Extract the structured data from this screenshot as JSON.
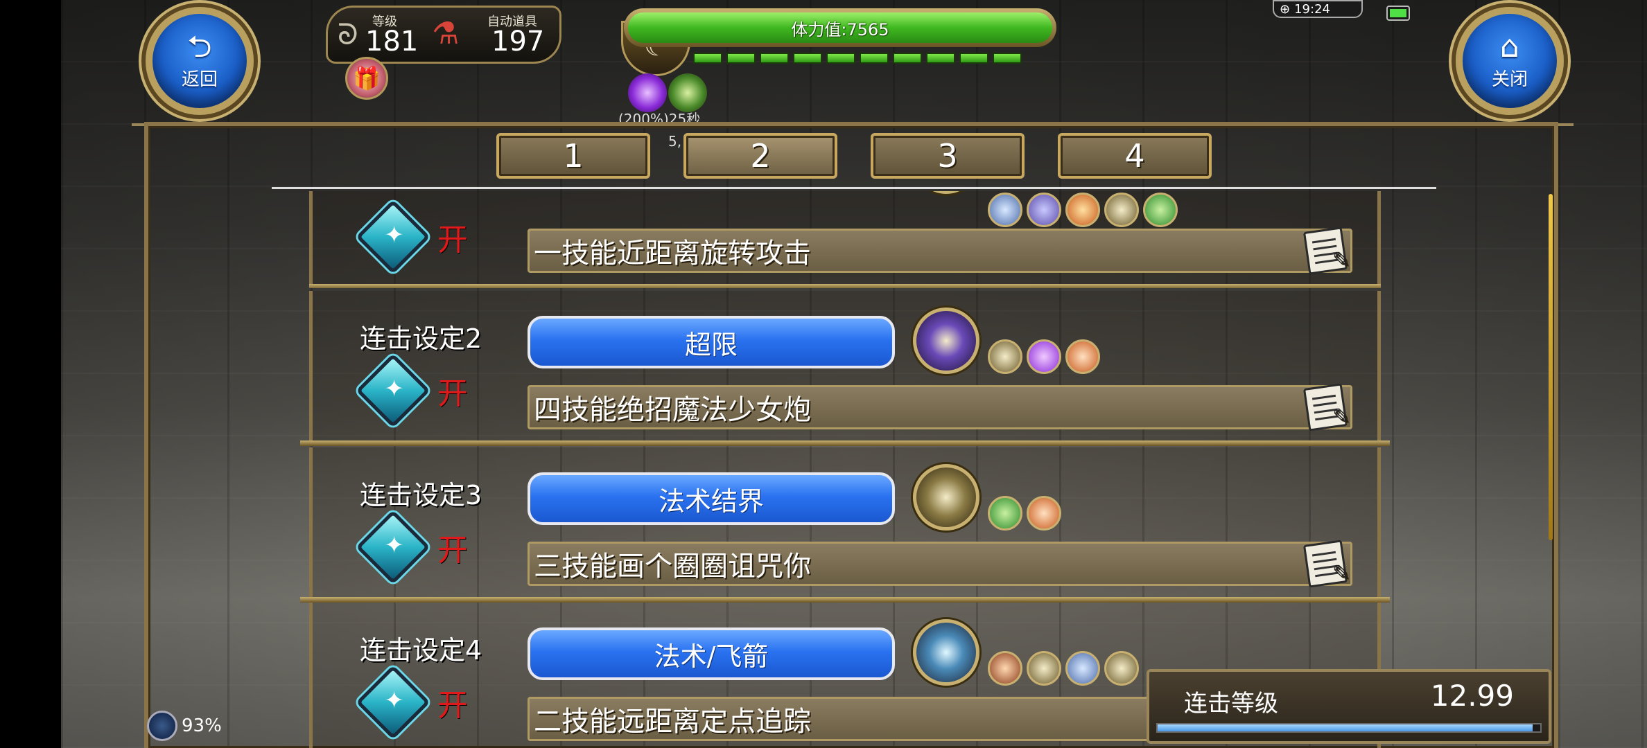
{
  "hud": {
    "back_label": "返回",
    "close_label": "关闭",
    "level_label": "等级",
    "level_value": "181",
    "auto_item_label": "自动道具",
    "auto_item_value": "197",
    "stamina_label": "体力值:7565",
    "buff_text_1": "(200%)25秒",
    "buff_text_2": "5,",
    "clock": "19:24"
  },
  "tabs": [
    "1",
    "2",
    "3",
    "4"
  ],
  "combo_rows": [
    {
      "label": "",
      "status": "开",
      "skill_name": "",
      "description": "一技能近距离旋转攻击"
    },
    {
      "label": "连击设定2",
      "status": "开",
      "skill_name": "超限",
      "description": "四技能绝招魔法少女炮"
    },
    {
      "label": "连击设定3",
      "status": "开",
      "skill_name": "法术结界",
      "description": "三技能画个圈圈诅咒你"
    },
    {
      "label": "连击设定4",
      "status": "开",
      "skill_name": "法术/飞箭",
      "description": "二技能远距离定点追踪"
    }
  ],
  "combo_level": {
    "label": "连击等级",
    "value": "12.99",
    "fill_fraction": 0.98
  },
  "bottom_status": {
    "percent": "93%"
  },
  "colors": {
    "skill_button": "#2a72f0",
    "on_status": "#e01a1a",
    "stamina": "#3fb820",
    "frame_gold": "#c8b070"
  },
  "icons": {
    "back": "back-arrow-icon",
    "close": "home-icon",
    "note": "clipboard-edit-icon",
    "gem": "diamond-gem-icon"
  }
}
